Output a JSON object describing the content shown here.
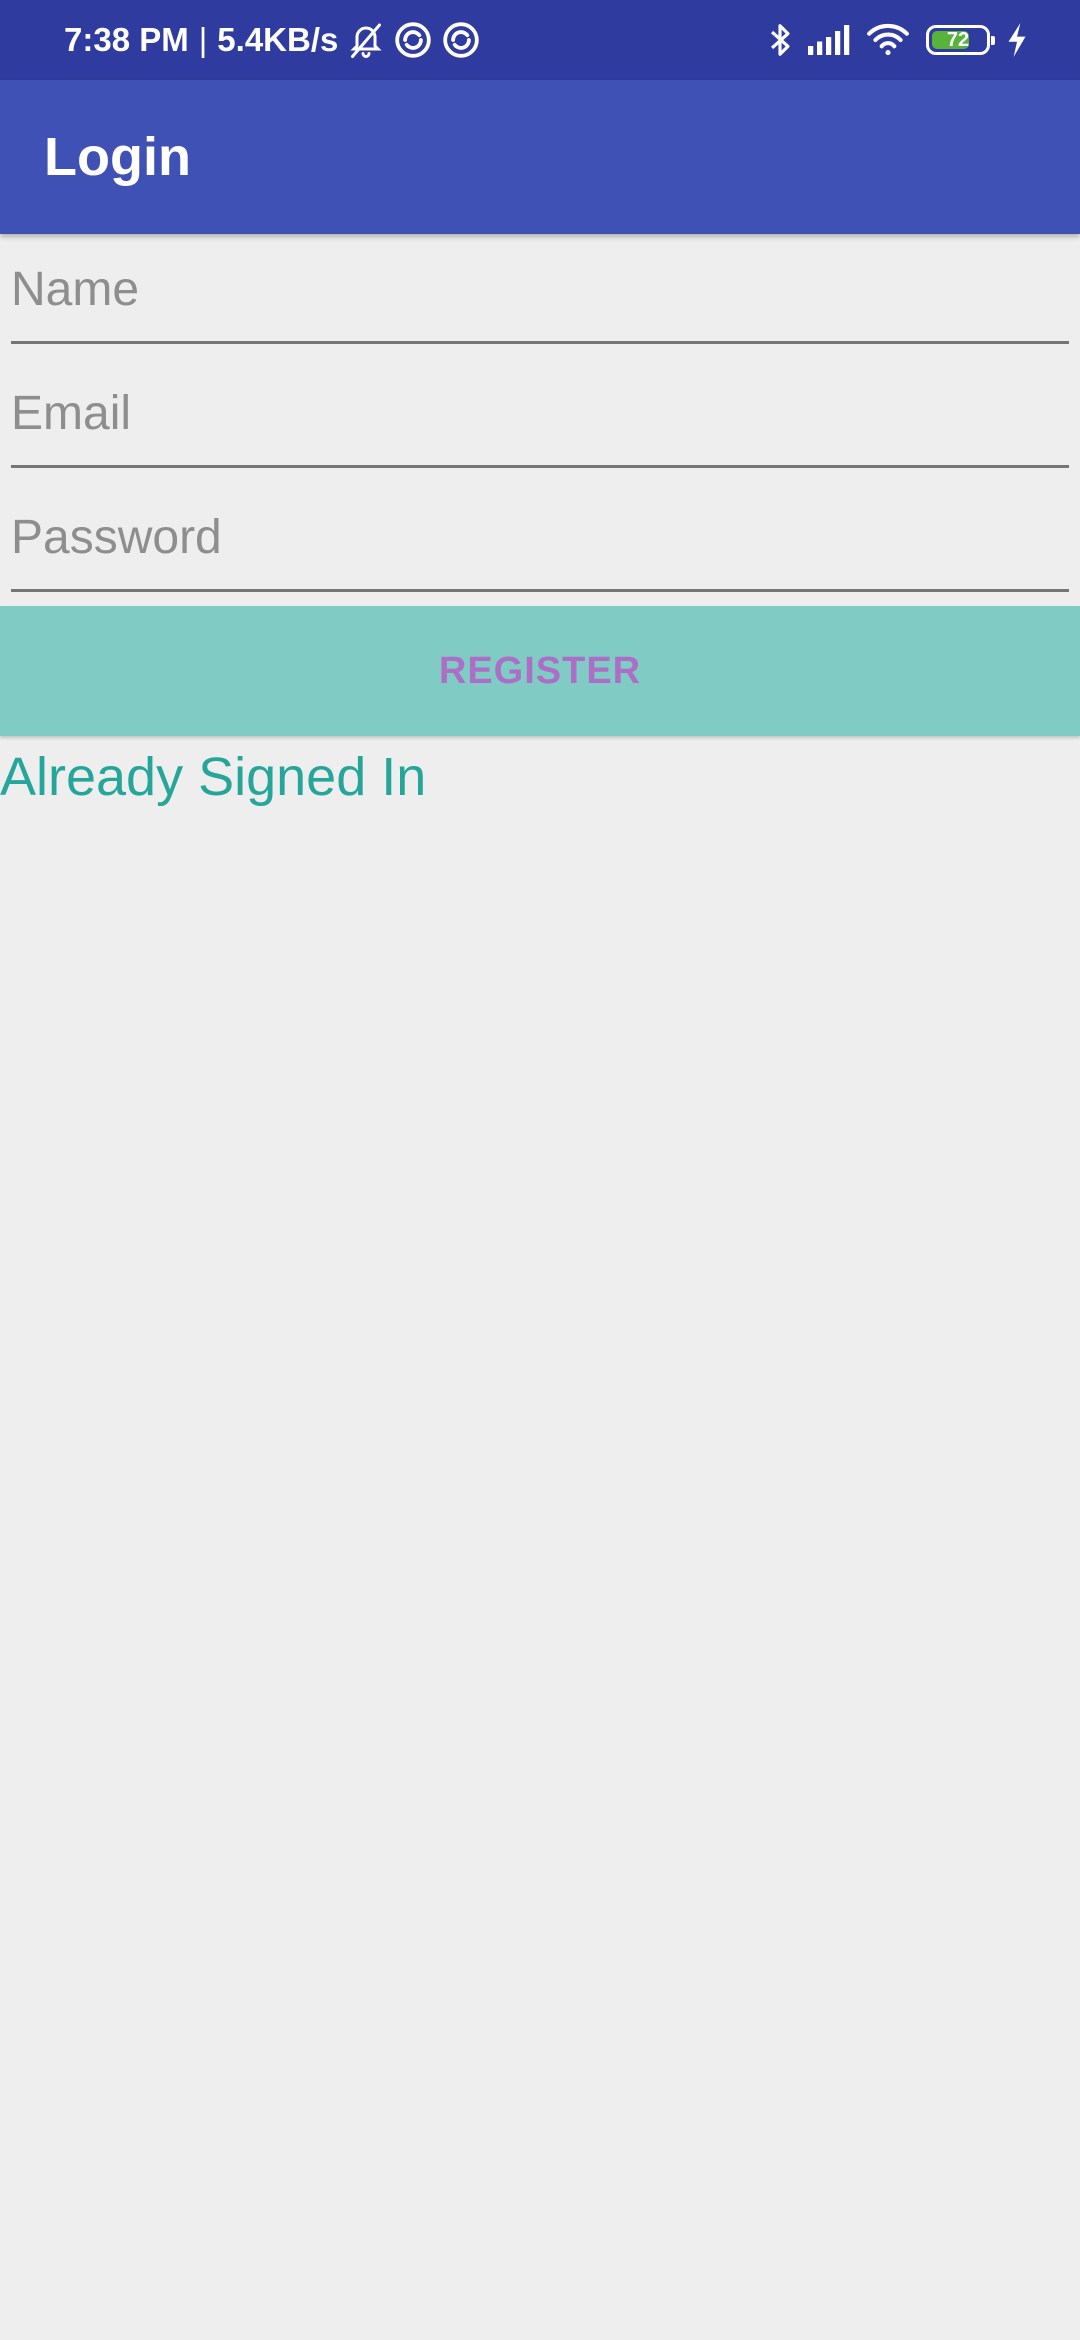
{
  "status_bar": {
    "time": "7:38 PM",
    "separator": "|",
    "network_speed": "5.4KB/s",
    "left_icons": [
      "bell-off-icon",
      "sync-circle-icon",
      "sync-circle-icon"
    ],
    "right_icons": [
      "bluetooth-icon",
      "signal-icon",
      "wifi-icon",
      "battery-icon",
      "charging-icon"
    ],
    "battery_percent": "72",
    "battery_level": 0.72,
    "colors": {
      "background": "#2f3b9e",
      "battery_fill": "#58b33a"
    }
  },
  "app_bar": {
    "title": "Login",
    "color": "#3f51b5"
  },
  "form": {
    "name_placeholder": "Name",
    "email_placeholder": "Email",
    "password_placeholder": "Password",
    "name_value": "",
    "email_value": "",
    "password_value": ""
  },
  "register_button": {
    "label": "REGISTER",
    "background": "#80cbc4",
    "text_color": "#ad6ec8"
  },
  "already_signed_in": {
    "label": "Already Signed In",
    "color": "#26a69a"
  }
}
